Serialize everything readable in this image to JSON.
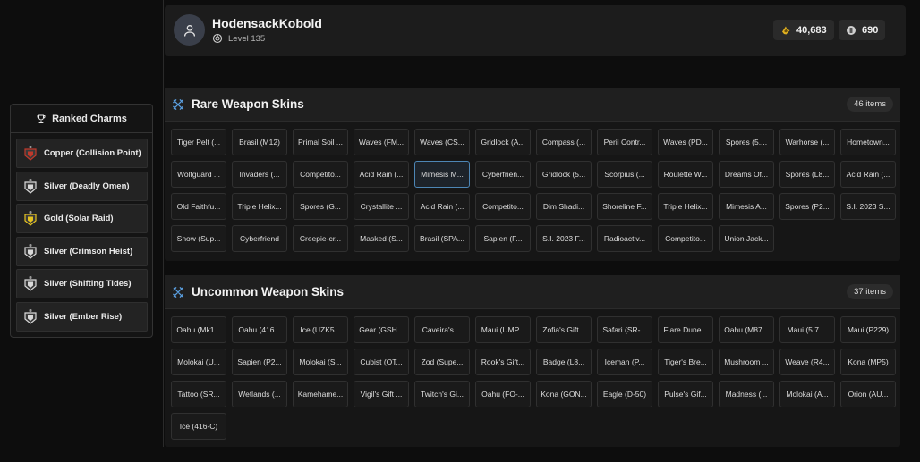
{
  "profile": {
    "username": "HodensackKobold",
    "level": "Level 135",
    "currency_primary": "40,683",
    "currency_secondary": "690"
  },
  "charms": {
    "title": "Ranked Charms",
    "items": [
      {
        "label": "Copper (Collision Point)",
        "tier": "copper"
      },
      {
        "label": "Silver (Deadly Omen)",
        "tier": "silver"
      },
      {
        "label": "Gold (Solar Raid)",
        "tier": "gold"
      },
      {
        "label": "Silver (Crimson Heist)",
        "tier": "silver"
      },
      {
        "label": "Silver (Shifting Tides)",
        "tier": "silver"
      },
      {
        "label": "Silver (Ember Rise)",
        "tier": "silver"
      }
    ]
  },
  "rare": {
    "title": "Rare Weapon Skins",
    "count": "46 items",
    "selected_index": 16,
    "items": [
      "Tiger Pelt (...",
      "Brasil (M12)",
      "Primal Soil ...",
      "Waves (FM...",
      "Waves (CS...",
      "Gridlock (A...",
      "Compass (...",
      "Peril Contr...",
      "Waves (PD...",
      "Spores (5....",
      "Warhorse (...",
      "Hometown...",
      "Wolfguard ...",
      "Invaders (...",
      "Competito...",
      "Acid Rain (...",
      "Mimesis M...",
      "Cyberfrien...",
      "Gridlock (5...",
      "Scorpius (...",
      "Roulette W...",
      "Dreams Of...",
      "Spores (L8...",
      "Acid Rain (...",
      "Old Faithfu...",
      "Triple Helix...",
      "Spores (G...",
      "Crystallite ...",
      "Acid Rain (...",
      "Competito...",
      "Dim Shadi...",
      "Shoreline F...",
      "Triple Helix...",
      "Mimesis A...",
      "Spores (P2...",
      "S.I. 2023 S...",
      "Snow (Sup...",
      "Cyberfriend",
      "Creepie-cr...",
      "Masked (S...",
      "Brasil (SPA...",
      "Sapien (F...",
      "S.I. 2023 F...",
      "Radioactiv...",
      "Competito...",
      "Union Jack..."
    ]
  },
  "uncommon": {
    "title": "Uncommon Weapon Skins",
    "count": "37 items",
    "items": [
      "Oahu (Mk1...",
      "Oahu (416...",
      "Ice (UZK5...",
      "Gear (GSH...",
      "Caveira's ...",
      "Maui (UMP...",
      "Zofia's Gift...",
      "Safari (SR-...",
      "Flare Dune...",
      "Oahu (M87...",
      "Maui (5.7 ...",
      "Maui (P229)",
      "Molokai (U...",
      "Sapien (P2...",
      "Molokai (S...",
      "Cubist (OT...",
      "Zod (Supe...",
      "Rook's Gift...",
      "Badge (L8...",
      "Iceman (P...",
      "Tiger's Bre...",
      "Mushroom ...",
      "Weave (R4...",
      "Kona (MP5)",
      "Tattoo (SR...",
      "Wetlands (...",
      "Kamehame...",
      "Vigil's Gift ...",
      "Twitch's Gi...",
      "Oahu (FO-...",
      "Kona (GON...",
      "Eagle (D-50)",
      "Pulse's Gif...",
      "Madness (...",
      "Molokai (A...",
      "Orion (AU...",
      "Ice (416-C)"
    ]
  },
  "colors": {
    "accent_blue": "#4d86b5",
    "copper": "#c0392b",
    "silver": "#d9d9d9",
    "gold": "#e6c320"
  },
  "icons": {
    "charms_title": "trophy-icon",
    "avatar": "user-icon",
    "level": "level-icon",
    "currency_primary": "renown-icon",
    "currency_secondary": "credits-icon",
    "section": "crossed-swords-icon"
  }
}
